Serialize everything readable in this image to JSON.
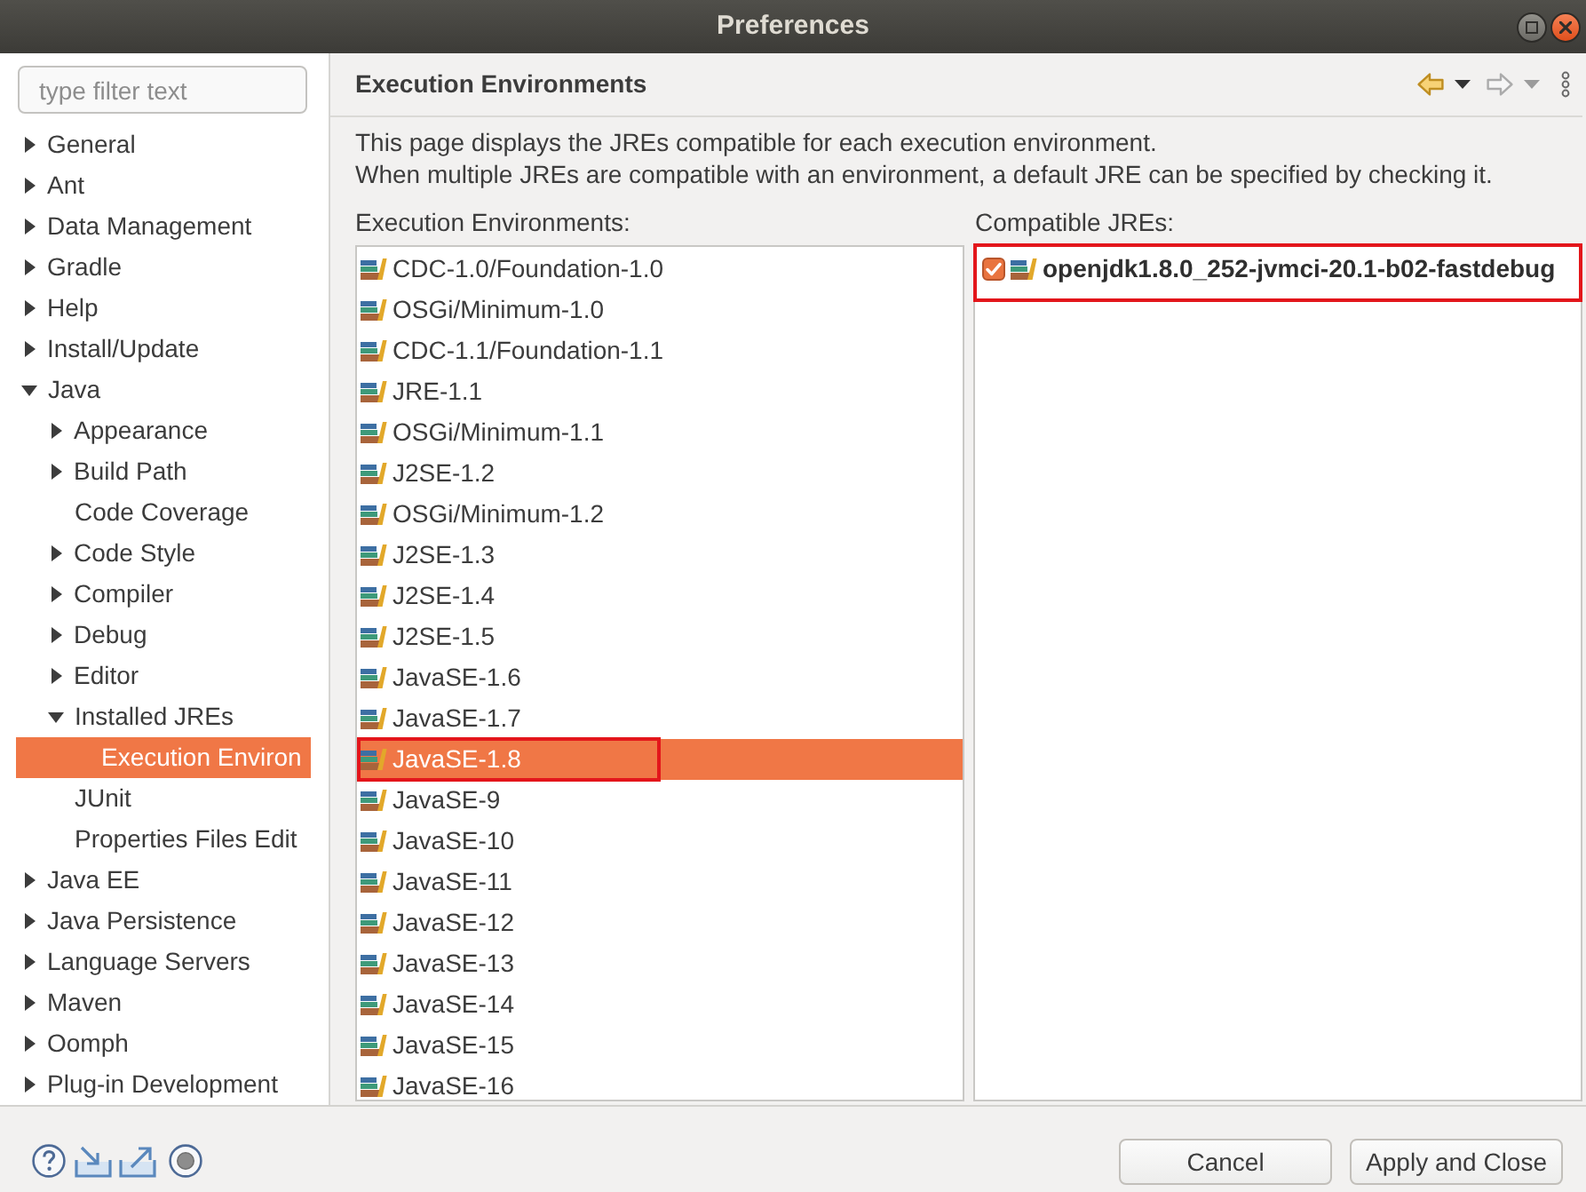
{
  "window": {
    "title": "Preferences"
  },
  "sidebar": {
    "filter": {
      "placeholder": "type filter text"
    },
    "tree": [
      {
        "label": "General",
        "kind": "branch",
        "expanded": false,
        "selected": false
      },
      {
        "label": "Ant",
        "kind": "branch",
        "expanded": false,
        "selected": false
      },
      {
        "label": "Data Management",
        "kind": "branch",
        "expanded": false,
        "selected": false
      },
      {
        "label": "Gradle",
        "kind": "branch",
        "expanded": false,
        "selected": false
      },
      {
        "label": "Help",
        "kind": "branch",
        "expanded": false,
        "selected": false
      },
      {
        "label": "Install/Update",
        "kind": "branch",
        "expanded": false,
        "selected": false
      },
      {
        "label": "Java",
        "kind": "branch",
        "expanded": true,
        "selected": false,
        "children": [
          {
            "label": "Appearance",
            "kind": "branch",
            "expanded": false,
            "selected": false
          },
          {
            "label": "Build Path",
            "kind": "branch",
            "expanded": false,
            "selected": false
          },
          {
            "label": "Code Coverage",
            "kind": "leaf",
            "selected": false
          },
          {
            "label": "Code Style",
            "kind": "branch",
            "expanded": false,
            "selected": false
          },
          {
            "label": "Compiler",
            "kind": "branch",
            "expanded": false,
            "selected": false
          },
          {
            "label": "Debug",
            "kind": "branch",
            "expanded": false,
            "selected": false
          },
          {
            "label": "Editor",
            "kind": "branch",
            "expanded": false,
            "selected": false
          },
          {
            "label": "Installed JREs",
            "kind": "branch",
            "expanded": true,
            "selected": false,
            "children": [
              {
                "label": "Execution Environ",
                "kind": "leaf",
                "selected": true
              }
            ]
          },
          {
            "label": "JUnit",
            "kind": "leaf",
            "selected": false
          },
          {
            "label": "Properties Files Edit",
            "kind": "leaf",
            "selected": false
          }
        ]
      },
      {
        "label": "Java EE",
        "kind": "branch",
        "expanded": false,
        "selected": false
      },
      {
        "label": "Java Persistence",
        "kind": "branch",
        "expanded": false,
        "selected": false
      },
      {
        "label": "Language Servers",
        "kind": "branch",
        "expanded": false,
        "selected": false
      },
      {
        "label": "Maven",
        "kind": "branch",
        "expanded": false,
        "selected": false
      },
      {
        "label": "Oomph",
        "kind": "branch",
        "expanded": false,
        "selected": false
      },
      {
        "label": "Plug-in Development",
        "kind": "branch",
        "expanded": false,
        "selected": false
      }
    ]
  },
  "page": {
    "title": "Execution Environments",
    "navigation": {
      "back": {
        "disabled": false
      },
      "forward": {
        "disabled": true
      }
    },
    "description": [
      "This page displays the JREs compatible for each execution environment.",
      "When multiple JREs are compatible with an environment, a default JRE can be specified by checking it."
    ],
    "environments": {
      "label": "Execution Environments:",
      "items": [
        {
          "name": "CDC-1.0/Foundation-1.0",
          "selected": false,
          "annotated": false
        },
        {
          "name": "OSGi/Minimum-1.0",
          "selected": false,
          "annotated": false
        },
        {
          "name": "CDC-1.1/Foundation-1.1",
          "selected": false,
          "annotated": false
        },
        {
          "name": "JRE-1.1",
          "selected": false,
          "annotated": false
        },
        {
          "name": "OSGi/Minimum-1.1",
          "selected": false,
          "annotated": false
        },
        {
          "name": "J2SE-1.2",
          "selected": false,
          "annotated": false
        },
        {
          "name": "OSGi/Minimum-1.2",
          "selected": false,
          "annotated": false
        },
        {
          "name": "J2SE-1.3",
          "selected": false,
          "annotated": false
        },
        {
          "name": "J2SE-1.4",
          "selected": false,
          "annotated": false
        },
        {
          "name": "J2SE-1.5",
          "selected": false,
          "annotated": false
        },
        {
          "name": "JavaSE-1.6",
          "selected": false,
          "annotated": false
        },
        {
          "name": "JavaSE-1.7",
          "selected": false,
          "annotated": false
        },
        {
          "name": "JavaSE-1.8",
          "selected": true,
          "annotated": true
        },
        {
          "name": "JavaSE-9",
          "selected": false,
          "annotated": false
        },
        {
          "name": "JavaSE-10",
          "selected": false,
          "annotated": false
        },
        {
          "name": "JavaSE-11",
          "selected": false,
          "annotated": false
        },
        {
          "name": "JavaSE-12",
          "selected": false,
          "annotated": false
        },
        {
          "name": "JavaSE-13",
          "selected": false,
          "annotated": false
        },
        {
          "name": "JavaSE-14",
          "selected": false,
          "annotated": false
        },
        {
          "name": "JavaSE-15",
          "selected": false,
          "annotated": false
        },
        {
          "name": "JavaSE-16",
          "selected": false,
          "annotated": false
        }
      ]
    },
    "compatible_jres": {
      "label": "Compatible JREs:",
      "items": [
        {
          "name": "openjdk1.8.0_252-jvmci-20.1-b02-fastdebug",
          "checked": true,
          "annotated": true
        }
      ]
    }
  },
  "buttons": [
    "Cancel",
    "Apply and Close"
  ]
}
